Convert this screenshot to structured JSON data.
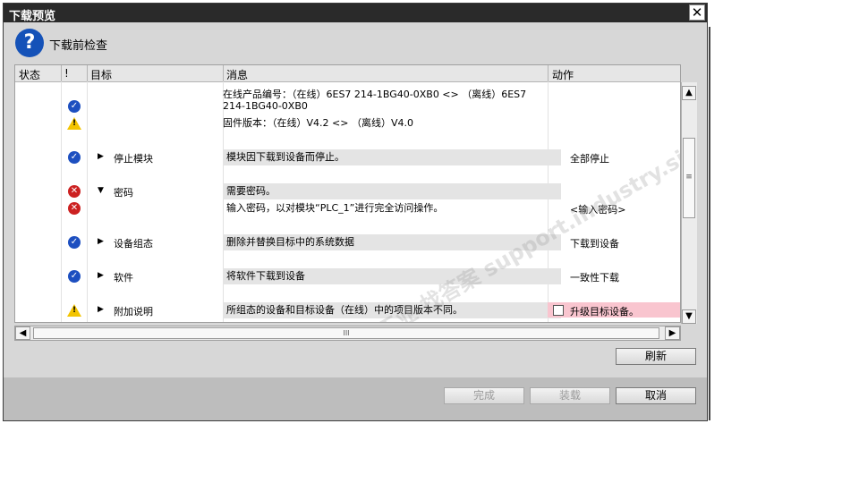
{
  "window": {
    "title": "下载预览"
  },
  "header": {
    "text": "下载前检查"
  },
  "columns": {
    "status": "状态",
    "alert": "!",
    "target": "目标",
    "message": "消息",
    "action": "动作"
  },
  "rows": [
    {
      "icon": "ok",
      "message": "在线产品编号：（在线）6ES7 214-1BG40-0XB0 <> （离线）6ES7 214-1BG40-0XB0"
    },
    {
      "icon": "warn",
      "message": "固件版本：（在线）V4.2 <> （离线）V4.0"
    },
    {
      "icon": "ok",
      "target": "停止模块",
      "message": "模块因下载到设备而停止。",
      "action": "全部停止"
    },
    {
      "icon": "err",
      "target": "密码",
      "message": "需要密码。"
    },
    {
      "icon": "err",
      "message": "输入密码，以对模块“PLC_1”进行完全访问操作。",
      "action": "<输入密码>"
    },
    {
      "icon": "ok",
      "target": "设备组态",
      "message": "删除并替换目标中的系统数据",
      "action": "下载到设备"
    },
    {
      "icon": "ok",
      "target": "软件",
      "message": "将软件下载到设备",
      "action": "一致性下载"
    },
    {
      "icon": "warn",
      "target": "附加说明",
      "message": "所组态的设备和目标设备（在线）中的项目版本不同。",
      "action": "升级目标设备。"
    }
  ],
  "watermark": "西门子工业 找答案 support.industry.siemens.com/cs",
  "buttons": {
    "refresh": "刷新",
    "finish": "完成",
    "load": "装载",
    "cancel": "取消"
  },
  "scrollbar": {
    "h_grip": "III",
    "v_grip": "≡"
  },
  "icons": {
    "close": "close-icon",
    "question": "question-icon"
  }
}
